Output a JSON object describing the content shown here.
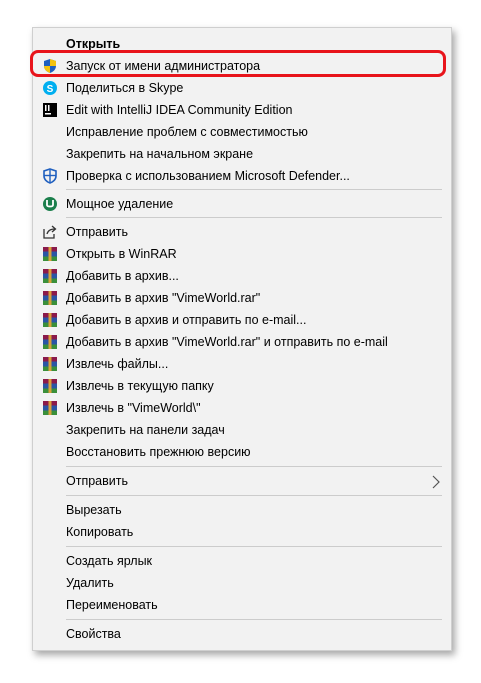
{
  "context_menu": {
    "items": [
      {
        "label": "Открыть",
        "icon": null,
        "bold": true
      },
      {
        "label": "Запуск от имени администратора",
        "icon": "uac-shield-icon"
      },
      {
        "label": "Поделиться в Skype",
        "icon": "skype-icon"
      },
      {
        "label": "Edit with IntelliJ IDEA Community Edition",
        "icon": "intellij-icon"
      },
      {
        "label": "Исправление проблем с совместимостью",
        "icon": null
      },
      {
        "label": "Закрепить на начальном экране",
        "icon": null
      },
      {
        "label": "Проверка с использованием Microsoft Defender...",
        "icon": "defender-icon"
      },
      {
        "label": "Мощное удаление",
        "icon": "uninstaller-icon"
      },
      {
        "label": "Отправить",
        "icon": "share-icon"
      },
      {
        "label": "Открыть в WinRAR",
        "icon": "winrar-icon"
      },
      {
        "label": "Добавить в архив...",
        "icon": "winrar-icon"
      },
      {
        "label": "Добавить в архив \"VimeWorld.rar\"",
        "icon": "winrar-icon"
      },
      {
        "label": "Добавить в архив и отправить по e-mail...",
        "icon": "winrar-icon"
      },
      {
        "label": "Добавить в архив \"VimeWorld.rar\" и отправить по e-mail",
        "icon": "winrar-icon"
      },
      {
        "label": "Извлечь файлы...",
        "icon": "winrar-icon"
      },
      {
        "label": "Извлечь в текущую папку",
        "icon": "winrar-icon"
      },
      {
        "label": "Извлечь в \"VimeWorld\\\"",
        "icon": "winrar-icon"
      },
      {
        "label": "Закрепить на панели задач",
        "icon": null
      },
      {
        "label": "Восстановить прежнюю версию",
        "icon": null
      },
      {
        "label": "Отправить",
        "icon": null,
        "submenu": true
      },
      {
        "label": "Вырезать",
        "icon": null
      },
      {
        "label": "Копировать",
        "icon": null
      },
      {
        "label": "Создать ярлык",
        "icon": null
      },
      {
        "label": "Удалить",
        "icon": null
      },
      {
        "label": "Переименовать",
        "icon": null
      },
      {
        "label": "Свойства",
        "icon": null
      }
    ],
    "highlighted_item": "Запуск от имени администратора",
    "highlight_color": "#e8141b"
  }
}
